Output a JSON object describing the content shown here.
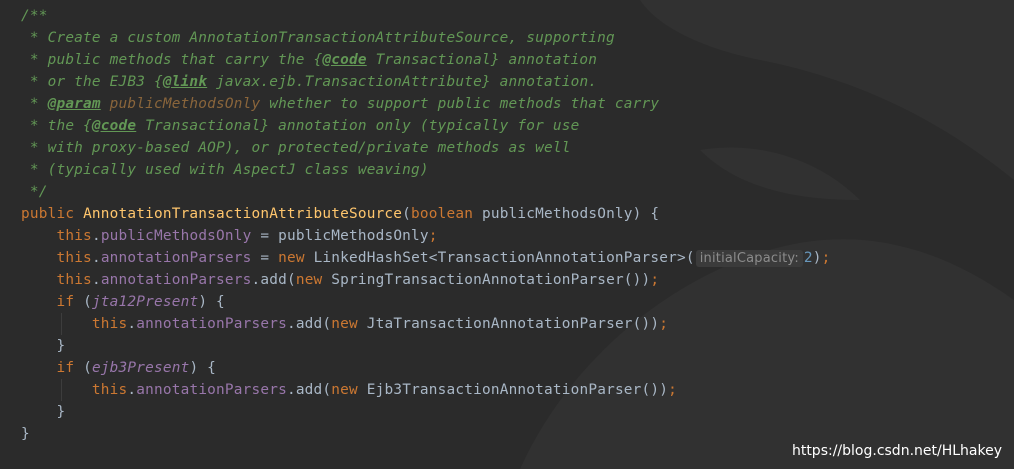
{
  "editor": {
    "lines": [
      [
        {
          "c": "cmt",
          "t": "/**"
        }
      ],
      [
        {
          "c": "cmt",
          "t": " * Create a custom AnnotationTransactionAttributeSource, supporting"
        }
      ],
      [
        {
          "c": "cmt",
          "t": " * public methods that carry the {"
        },
        {
          "c": "tag",
          "t": "@code"
        },
        {
          "c": "cmt",
          "t": " Transactional} annotation"
        }
      ],
      [
        {
          "c": "cmt",
          "t": " * or the EJB3 {"
        },
        {
          "c": "tag",
          "t": "@link"
        },
        {
          "c": "cmt",
          "t": " javax.ejb.TransactionAttribute} annotation."
        }
      ],
      [
        {
          "c": "cmt",
          "t": " * "
        },
        {
          "c": "tag",
          "t": "@param"
        },
        {
          "c": "cmt",
          "t": " "
        },
        {
          "c": "paramname",
          "t": "publicMethodsOnly"
        },
        {
          "c": "cmt",
          "t": " whether to support public methods that carry"
        }
      ],
      [
        {
          "c": "cmt",
          "t": " * the {"
        },
        {
          "c": "tag",
          "t": "@code"
        },
        {
          "c": "cmt",
          "t": " Transactional} annotation only (typically for use"
        }
      ],
      [
        {
          "c": "cmt",
          "t": " * with proxy-based AOP), or protected/private methods as well"
        }
      ],
      [
        {
          "c": "cmt",
          "t": " * (typically used with AspectJ class weaving)"
        }
      ],
      [
        {
          "c": "cmt",
          "t": " */"
        }
      ],
      [
        {
          "c": "kw",
          "t": "public "
        },
        {
          "c": "fn",
          "t": "AnnotationTransactionAttributeSource"
        },
        {
          "c": "",
          "t": "("
        },
        {
          "c": "kw",
          "t": "boolean "
        },
        {
          "c": "",
          "t": "publicMethodsOnly) {"
        }
      ],
      [
        {
          "c": "",
          "t": "    "
        },
        {
          "c": "kw",
          "t": "this"
        },
        {
          "c": "",
          "t": "."
        },
        {
          "c": "fld",
          "t": "publicMethodsOnly"
        },
        {
          "c": "",
          "t": " = publicMethodsOnly"
        },
        {
          "c": "kw",
          "t": ";"
        }
      ],
      [
        {
          "c": "",
          "t": "    "
        },
        {
          "c": "kw",
          "t": "this"
        },
        {
          "c": "",
          "t": "."
        },
        {
          "c": "fld",
          "t": "annotationParsers"
        },
        {
          "c": "",
          "t": " = "
        },
        {
          "c": "kw",
          "t": "new "
        },
        {
          "c": "",
          "t": "LinkedHashSet<TransactionAnnotationParser>("
        },
        {
          "c": "hint",
          "t": "initialCapacity:"
        },
        {
          "c": "num",
          "t": "2"
        },
        {
          "c": "",
          "t": ")"
        },
        {
          "c": "kw",
          "t": ";"
        }
      ],
      [
        {
          "c": "",
          "t": "    "
        },
        {
          "c": "kw",
          "t": "this"
        },
        {
          "c": "",
          "t": "."
        },
        {
          "c": "fld",
          "t": "annotationParsers"
        },
        {
          "c": "",
          "t": ".add("
        },
        {
          "c": "kw",
          "t": "new "
        },
        {
          "c": "",
          "t": "SpringTransactionAnnotationParser())"
        },
        {
          "c": "kw",
          "t": ";"
        }
      ],
      [
        {
          "c": "",
          "t": "    "
        },
        {
          "c": "kw",
          "t": "if "
        },
        {
          "c": "",
          "t": "("
        },
        {
          "c": "fld-i",
          "t": "jta12Present"
        },
        {
          "c": "",
          "t": ") {"
        }
      ],
      [
        {
          "c": "",
          "t": "        "
        },
        {
          "c": "kw",
          "t": "this"
        },
        {
          "c": "",
          "t": "."
        },
        {
          "c": "fld",
          "t": "annotationParsers"
        },
        {
          "c": "",
          "t": ".add("
        },
        {
          "c": "kw",
          "t": "new "
        },
        {
          "c": "",
          "t": "JtaTransactionAnnotationParser())"
        },
        {
          "c": "kw",
          "t": ";"
        }
      ],
      [
        {
          "c": "",
          "t": "    }"
        }
      ],
      [
        {
          "c": "",
          "t": "    "
        },
        {
          "c": "kw",
          "t": "if "
        },
        {
          "c": "",
          "t": "("
        },
        {
          "c": "fld-i",
          "t": "ejb3Present"
        },
        {
          "c": "",
          "t": ") {"
        }
      ],
      [
        {
          "c": "",
          "t": "        "
        },
        {
          "c": "kw",
          "t": "this"
        },
        {
          "c": "",
          "t": "."
        },
        {
          "c": "fld",
          "t": "annotationParsers"
        },
        {
          "c": "",
          "t": ".add("
        },
        {
          "c": "kw",
          "t": "new "
        },
        {
          "c": "",
          "t": "Ejb3TransactionAnnotationParser())"
        },
        {
          "c": "kw",
          "t": ";"
        }
      ],
      [
        {
          "c": "",
          "t": "    }"
        }
      ],
      [
        {
          "c": "",
          "t": "}"
        }
      ]
    ]
  },
  "watermark": "https://blog.csdn.net/HLhakey",
  "colors": {
    "background": "#2b2b2b",
    "comment": "#629755",
    "keyword": "#cc7832",
    "field": "#9876aa",
    "method_name": "#ffc66d",
    "number": "#6897bb",
    "text": "#a9b7c6"
  },
  "icons": {
    "background_logo": "intellij-logo-watermark-icon"
  }
}
